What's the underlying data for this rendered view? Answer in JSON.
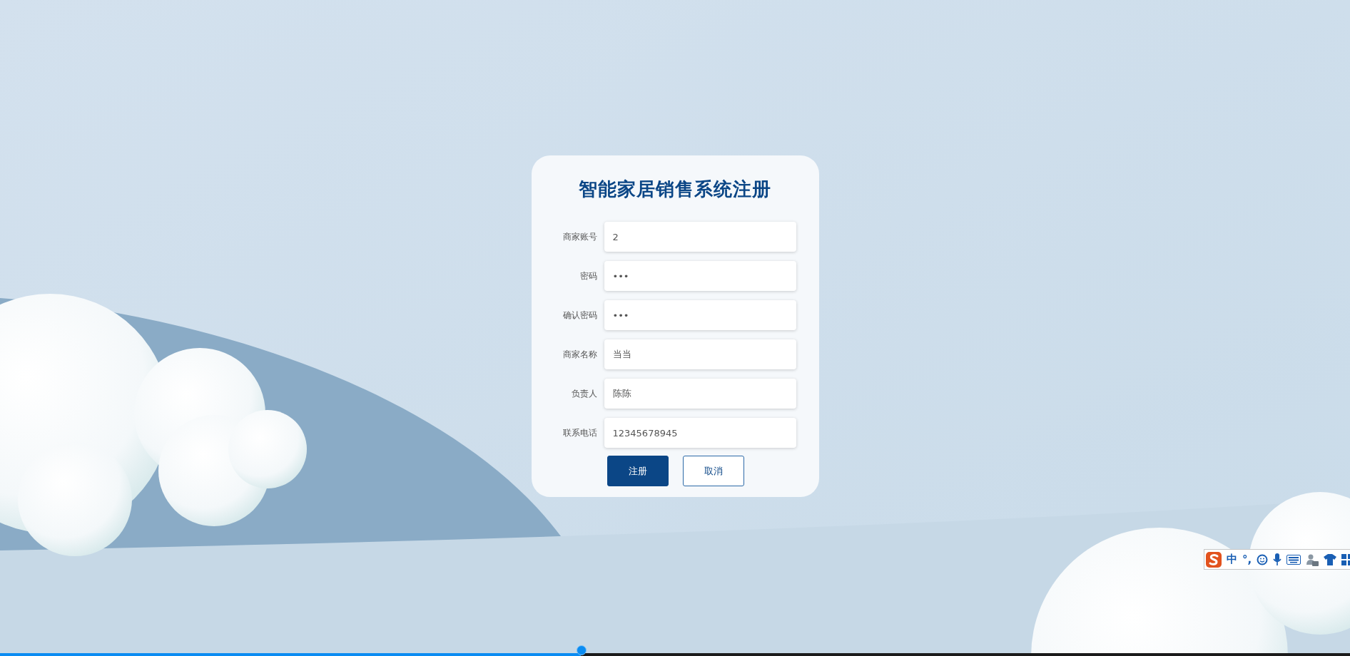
{
  "form": {
    "title": "智能家居销售系统注册",
    "fields": [
      {
        "label": "商家账号",
        "value": "2"
      },
      {
        "label": "密码",
        "value": "•••"
      },
      {
        "label": "确认密码",
        "value": "•••"
      },
      {
        "label": "商家名称",
        "value": "当当"
      },
      {
        "label": "负责人",
        "value": "陈陈"
      },
      {
        "label": "联系电话",
        "value": "12345678945"
      }
    ],
    "buttons": [
      {
        "label": "注册",
        "kind": "primary"
      },
      {
        "label": "取消",
        "kind": "secondary"
      }
    ]
  },
  "ime_toolbar": {
    "items": [
      {
        "kind": "logo"
      },
      {
        "kind": "text",
        "text": "中"
      },
      {
        "kind": "text",
        "text": "°,"
      },
      {
        "kind": "smiley"
      },
      {
        "kind": "mic"
      },
      {
        "kind": "keyboard"
      },
      {
        "kind": "person"
      },
      {
        "kind": "shirt"
      },
      {
        "kind": "grid"
      }
    ]
  },
  "video_progress": {
    "level": 0.43
  }
}
